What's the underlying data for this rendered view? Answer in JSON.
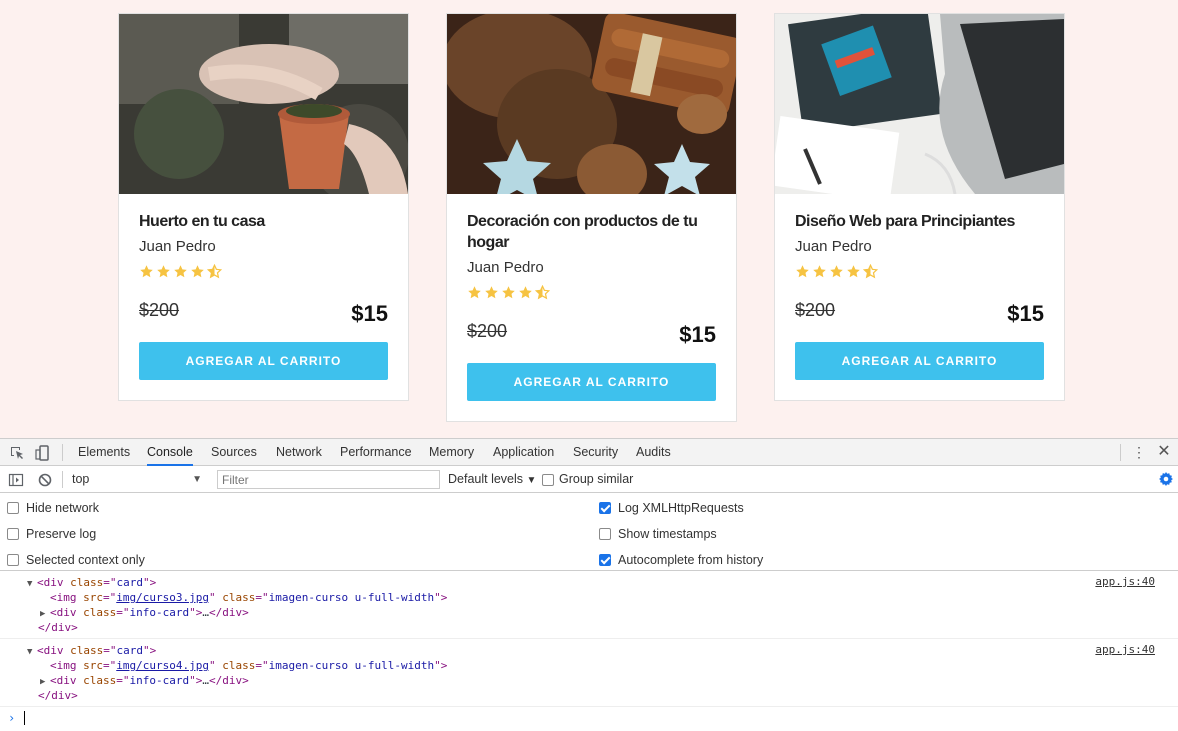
{
  "cards": [
    {
      "title": "Huerto en tu casa",
      "author": "Juan Pedro",
      "rating_stars": 4.5,
      "old_price": "$200",
      "new_price": "$15",
      "button": "AGREGAR AL CARRITO"
    },
    {
      "title": "Decoración con productos de tu hogar",
      "author": "Juan Pedro",
      "rating_stars": 4.5,
      "old_price": "$200",
      "new_price": "$15",
      "button": "AGREGAR AL CARRITO"
    },
    {
      "title": "Diseño Web para Principiantes",
      "author": "Juan Pedro",
      "rating_stars": 4.5,
      "old_price": "$200",
      "new_price": "$15",
      "button": "AGREGAR AL CARRITO"
    }
  ],
  "devtools": {
    "tabs": [
      "Elements",
      "Console",
      "Sources",
      "Network",
      "Performance",
      "Memory",
      "Application",
      "Security",
      "Audits"
    ],
    "active_tab": "Console",
    "context": "top",
    "filter_placeholder": "Filter",
    "levels": "Default levels",
    "group_similar": "Group similar",
    "settings": {
      "hide_network": "Hide network",
      "preserve_log": "Preserve log",
      "selected_context_only": "Selected context only",
      "log_xmlhttprequests": "Log XMLHttpRequests",
      "show_timestamps": "Show timestamps",
      "autocomplete_from_history": "Autocomplete from history"
    },
    "console_entries": [
      {
        "source": "app.js:40",
        "open_tag": "div",
        "class_attr": "class",
        "class_val": "card",
        "img_src": "img/curso3.jpg",
        "img_class": "imagen-curso u-full-width",
        "info_class": "info-card",
        "ellipsis": "…"
      },
      {
        "source": "app.js:40",
        "open_tag": "div",
        "class_attr": "class",
        "class_val": "card",
        "img_src": "img/curso4.jpg",
        "img_class": "imagen-curso u-full-width",
        "info_class": "info-card",
        "ellipsis": "…"
      }
    ]
  },
  "colors": {
    "page_background": "#fdf1ef",
    "button": "#3ec1ed",
    "star": "#f6c342",
    "devtools_accent": "#1a73e8"
  }
}
